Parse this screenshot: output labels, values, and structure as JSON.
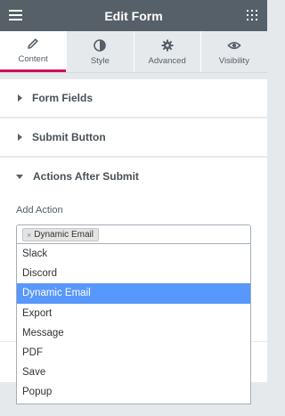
{
  "header": {
    "title": "Edit Form",
    "menu_icon": "hamburger-icon",
    "apps_icon": "grid-icon"
  },
  "tabs": [
    {
      "label": "Content",
      "icon": "pencil-icon",
      "active": true
    },
    {
      "label": "Style",
      "icon": "contrast-icon",
      "active": false
    },
    {
      "label": "Advanced",
      "icon": "gear-icon",
      "active": false
    },
    {
      "label": "Visibility",
      "icon": "eye-icon",
      "active": false
    }
  ],
  "sections": [
    {
      "label": "Form Fields",
      "expanded": false
    },
    {
      "label": "Submit Button",
      "expanded": false
    },
    {
      "label": "Actions After Submit",
      "expanded": true
    }
  ],
  "actions": {
    "label": "Add Action",
    "selected_tag": "Dynamic Email",
    "remove_symbol": "×",
    "options": [
      "Slack",
      "Discord",
      "Dynamic Email",
      "Export",
      "Message",
      "PDF",
      "Save",
      "Popup"
    ],
    "highlighted_index": 2
  },
  "colors": {
    "accent": "#d30c5c",
    "header_bg": "#556068",
    "highlight": "#5897fb"
  }
}
